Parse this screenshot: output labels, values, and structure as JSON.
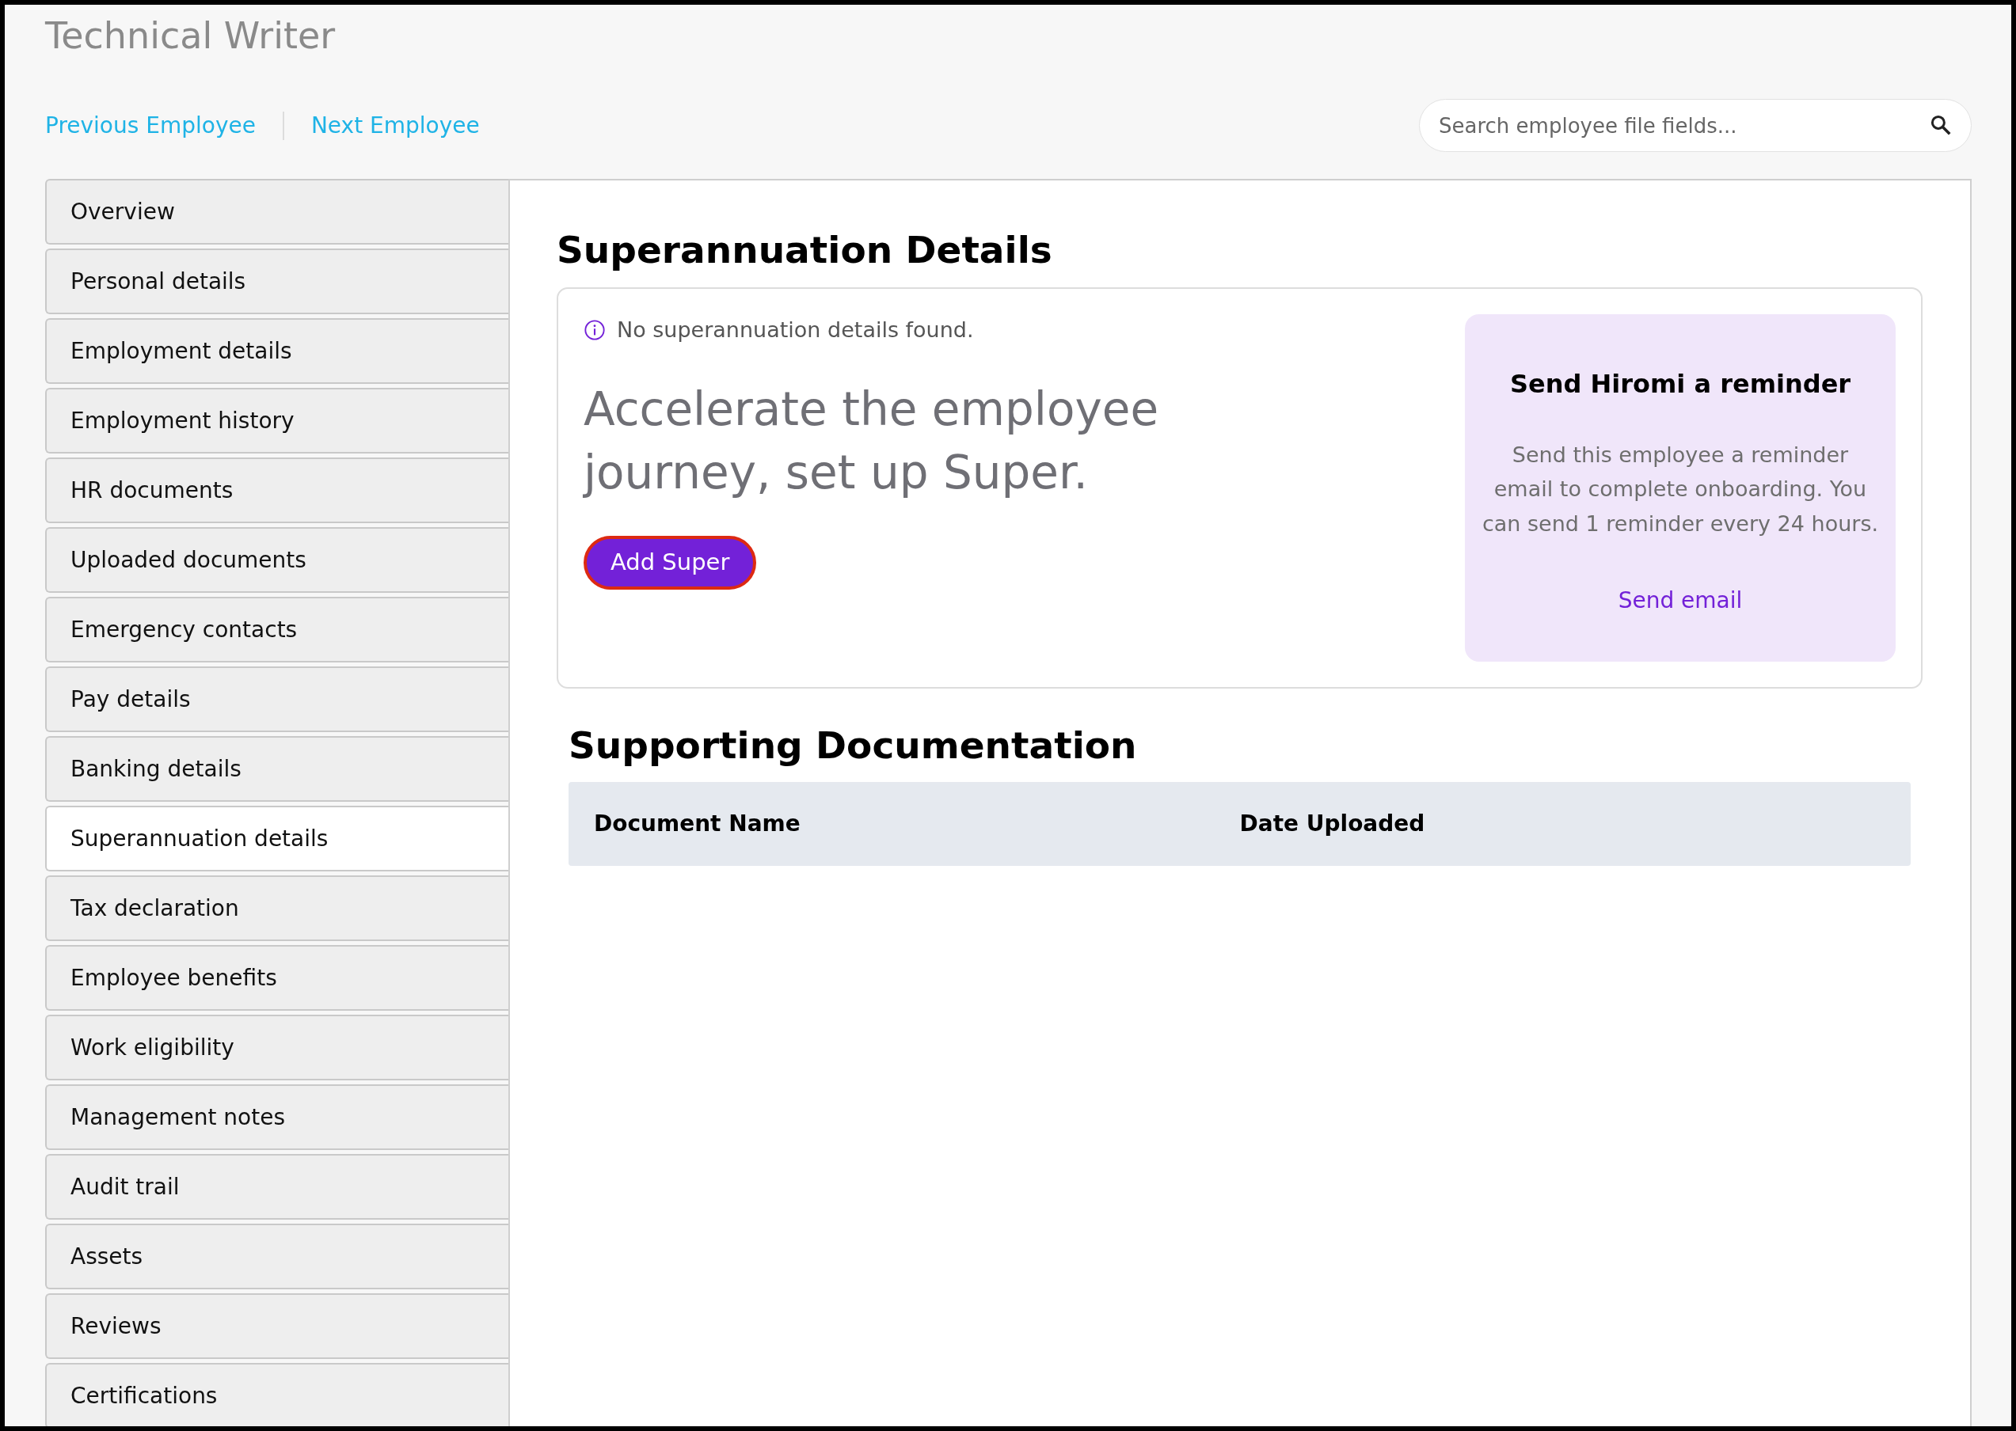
{
  "page_title": "Technical Writer",
  "nav_links": [
    "Previous Employee",
    "Next Employee"
  ],
  "search": {
    "placeholder": "Search employee file fields..."
  },
  "sidebar": {
    "items": [
      {
        "label": "Overview",
        "selected": false
      },
      {
        "label": "Personal details",
        "selected": false
      },
      {
        "label": "Employment details",
        "selected": false
      },
      {
        "label": "Employment history",
        "selected": false
      },
      {
        "label": "HR documents",
        "selected": false
      },
      {
        "label": "Uploaded documents",
        "selected": false
      },
      {
        "label": "Emergency contacts",
        "selected": false
      },
      {
        "label": "Pay details",
        "selected": false
      },
      {
        "label": "Banking details",
        "selected": false
      },
      {
        "label": "Superannuation details",
        "selected": true
      },
      {
        "label": "Tax declaration",
        "selected": false
      },
      {
        "label": "Employee benefits",
        "selected": false
      },
      {
        "label": "Work eligibility",
        "selected": false
      },
      {
        "label": "Management notes",
        "selected": false
      },
      {
        "label": "Audit trail",
        "selected": false
      },
      {
        "label": "Assets",
        "selected": false
      },
      {
        "label": "Reviews",
        "selected": false
      },
      {
        "label": "Certifications",
        "selected": false
      }
    ]
  },
  "superannuation": {
    "heading": "Superannuation Details",
    "notice": "No superannuation details found.",
    "headline": "Accelerate the employee journey, set up Super.",
    "button": "Add Super",
    "reminder": {
      "title": "Send Hiromi a reminder",
      "text": "Send this employee a reminder email to complete onboarding. You can send 1 reminder every 24 hours.",
      "link": "Send email"
    }
  },
  "documentation": {
    "heading": "Supporting Documentation",
    "columns": [
      "Document Name",
      "Date Uploaded"
    ]
  }
}
